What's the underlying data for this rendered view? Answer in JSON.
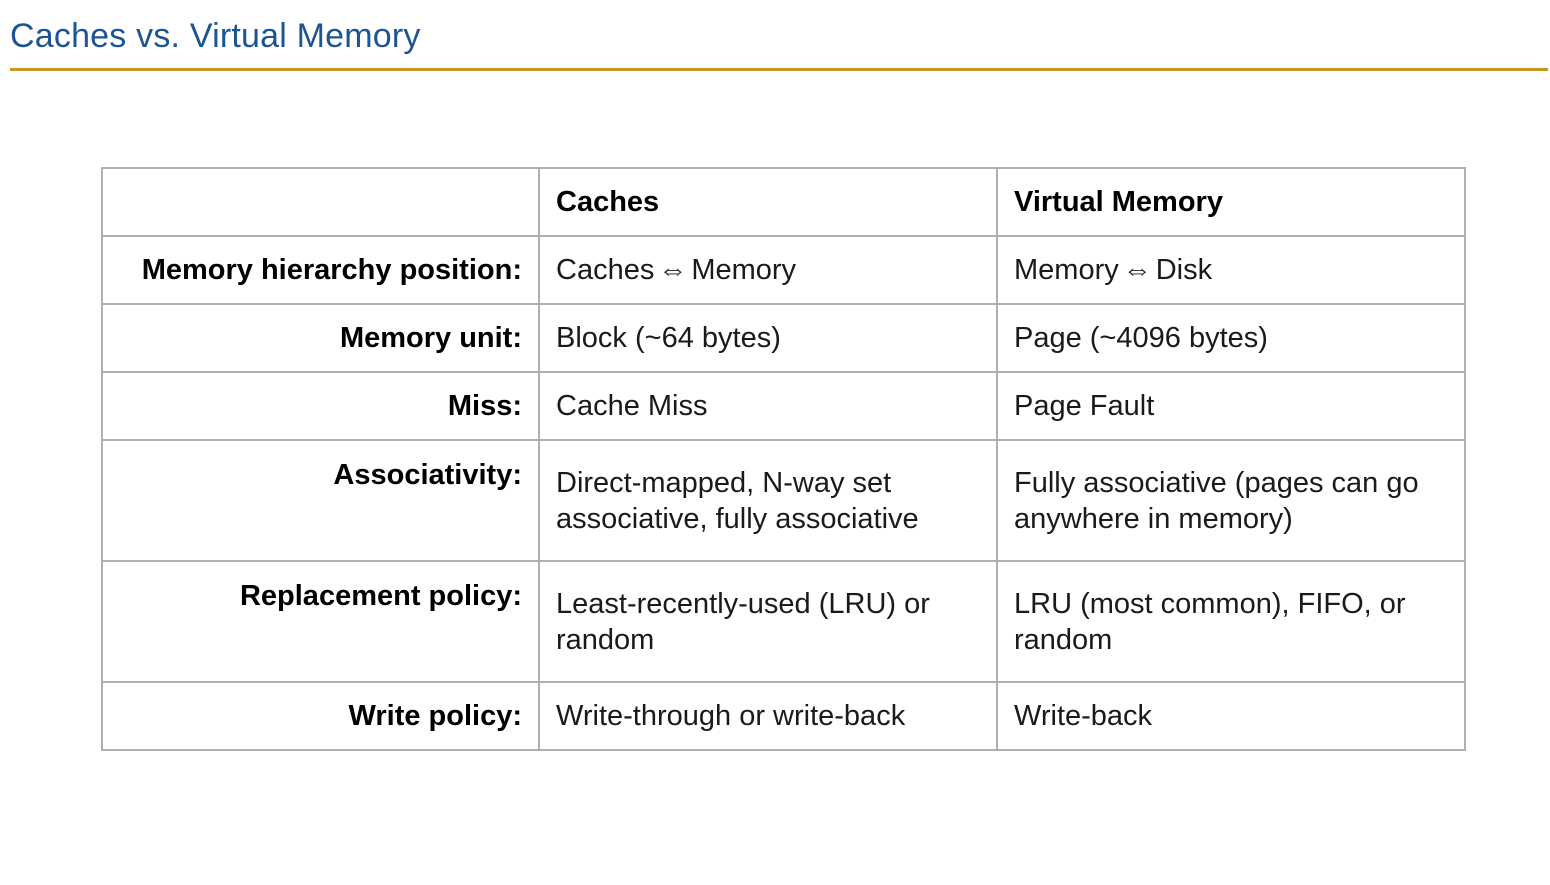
{
  "slide": {
    "title": "Caches vs. Virtual Memory",
    "colors": {
      "title": "#1c5592",
      "rule": "#c79a1e",
      "grid": "#b0b0b0"
    }
  },
  "table": {
    "columns": [
      "",
      "Caches",
      "Virtual Memory"
    ],
    "rows": [
      {
        "label": "Memory hierarchy position:",
        "caches": {
          "from": "Caches",
          "arrow": "⇔",
          "to": "Memory"
        },
        "vm": {
          "from": "Memory",
          "arrow": "⇔",
          "to": "Disk"
        }
      },
      {
        "label": "Memory unit:",
        "caches": "Block (~64 bytes)",
        "vm": "Page (~4096 bytes)"
      },
      {
        "label": "Miss:",
        "caches": "Cache Miss",
        "vm": "Page Fault"
      },
      {
        "label": "Associativity:",
        "caches": "Direct-mapped, N-way set associative, fully associative",
        "vm": "Fully associative (pages can go anywhere in memory)"
      },
      {
        "label": "Replacement policy:",
        "caches": "Least-recently-used (LRU) or random",
        "vm": "LRU (most common), FIFO, or random"
      },
      {
        "label": "Write policy:",
        "caches": "Write-through or write-back",
        "vm": "Write-back"
      }
    ]
  }
}
